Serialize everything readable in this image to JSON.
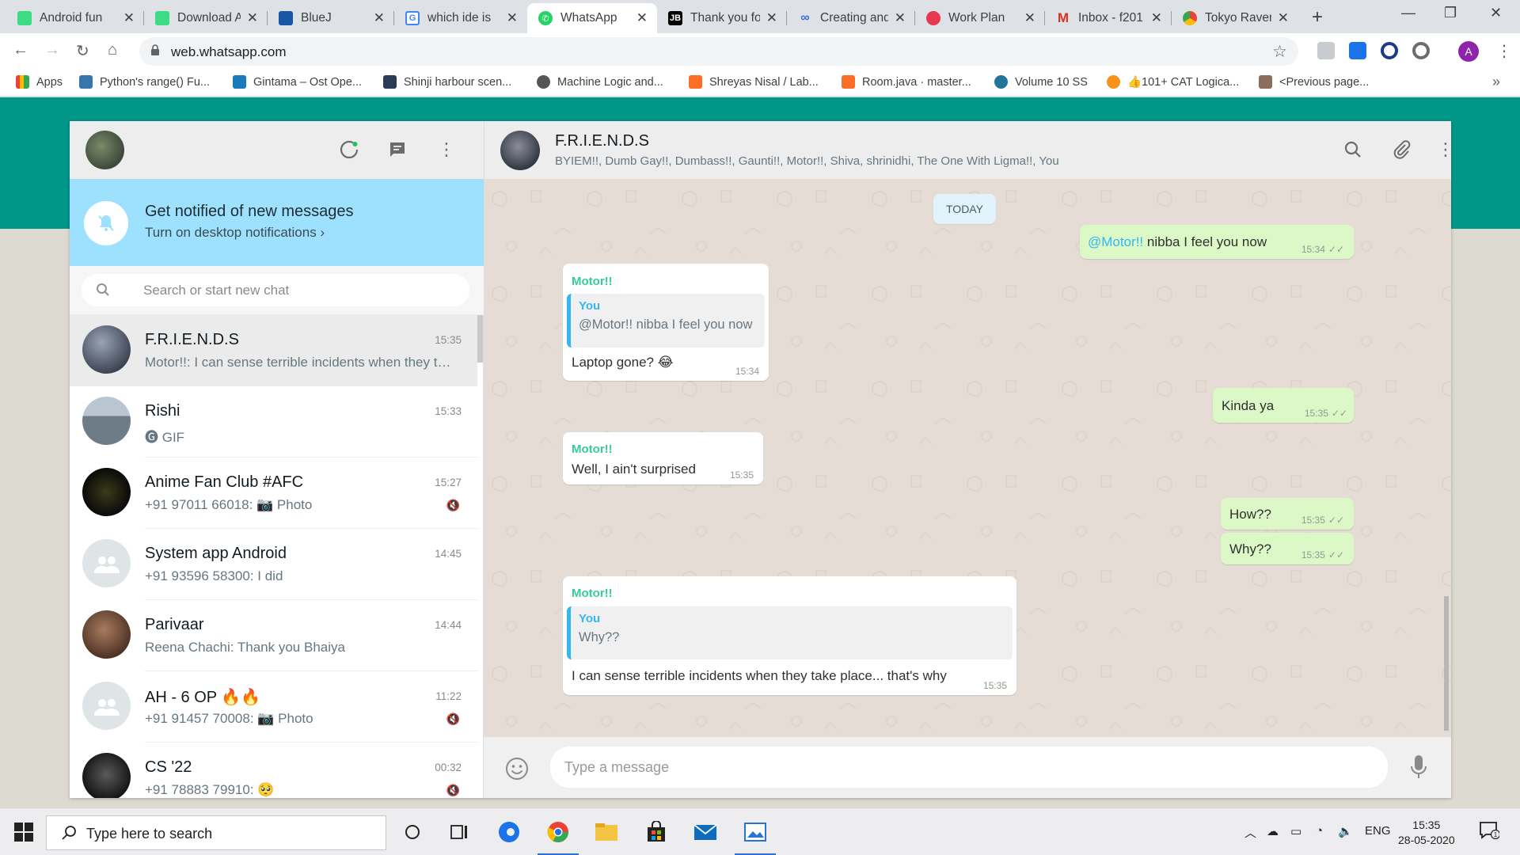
{
  "browser": {
    "tabs": [
      {
        "label": "Android fun",
        "icon": "android-developers-icon",
        "color": "#3ddc84"
      },
      {
        "label": "Download A",
        "icon": "android-studio-icon",
        "color": "#3ddc84"
      },
      {
        "label": "BlueJ",
        "icon": "bluej-icon",
        "color": "#1a56a8"
      },
      {
        "label": "which ide is",
        "icon": "google-icon",
        "color": "#4285f4"
      },
      {
        "label": "WhatsApp",
        "icon": "whatsapp-icon",
        "color": "#25d366",
        "active": true
      },
      {
        "label": "Thank you fo",
        "icon": "jetbrains-icon",
        "color": "#000000"
      },
      {
        "label": "Creating and",
        "icon": "link-icon",
        "color": "#3a6bd8"
      },
      {
        "label": "Work Plan",
        "icon": "asana-icon",
        "color": "#e8384f"
      },
      {
        "label": "Inbox - f201",
        "icon": "gmail-icon",
        "color": "#d93025"
      },
      {
        "label": "Tokyo Raven",
        "icon": "chrome-icon",
        "color": "#fbbc04"
      }
    ],
    "url": "web.whatsapp.com",
    "profile_initial": "A",
    "bookmarks": [
      {
        "label": "Apps",
        "icon": "apps-grid-icon",
        "color": "#4285f4"
      },
      {
        "label": "Python's range() Fu...",
        "icon": "python-icon",
        "color": "#3776ab"
      },
      {
        "label": "Gintama – Ost Ope...",
        "icon": "scribd-icon",
        "color": "#1a7bba"
      },
      {
        "label": "Shinji harbour scen...",
        "icon": "vlc-like-icon",
        "color": "#2b3a55"
      },
      {
        "label": "Machine Logic and...",
        "icon": "globe-icon",
        "color": "#555555"
      },
      {
        "label": "Shreyas Nisal / Lab...",
        "icon": "gitlab-icon",
        "color": "#fc6d26"
      },
      {
        "label": "Room.java · master...",
        "icon": "gitlab-icon",
        "color": "#fc6d26"
      },
      {
        "label": "Volume 10 SS",
        "icon": "wordpress-icon",
        "color": "#21759b"
      },
      {
        "label": "👍101+ CAT Logica...",
        "icon": "bitcoin-icon",
        "color": "#f7931a"
      },
      {
        "label": "<Previous page...",
        "icon": "avatar-icon",
        "color": "#8a6d5a"
      }
    ]
  },
  "whatsapp": {
    "notify_title": "Get notified of new messages",
    "notify_link": "Turn on desktop notifications ›",
    "search_placeholder": "Search or start new chat",
    "chats": [
      {
        "name": "F.R.I.E.N.D.S",
        "time": "15:35",
        "preview": "Motor!!: I can sense terrible incidents when they take place... that's why",
        "muted": false,
        "selected": true,
        "avatar_color": "#5a6272"
      },
      {
        "name": "Rishi",
        "time": "15:33",
        "preview": "🅖 GIF",
        "muted": false,
        "avatar_color": "#8c9aa8"
      },
      {
        "name": "Anime Fan Club #AFC",
        "time": "15:27",
        "preview": "+91 97011 66018: 📷 Photo",
        "muted": true,
        "avatar_color": "#1a1a1a"
      },
      {
        "name": "System app Android",
        "time": "14:45",
        "preview": "+91 93596 58300: I did",
        "muted": false,
        "avatar_color": "#dfe5e7"
      },
      {
        "name": "Parivaar",
        "time": "14:44",
        "preview": "Reena Chachi: Thank you Bhaiya",
        "muted": false,
        "avatar_color": "#7a5a48"
      },
      {
        "name": "AH - 6 OP 🔥🔥",
        "time": "11:22",
        "preview": "+91 91457 70008: 📷 Photo",
        "muted": true,
        "avatar_color": "#dfe5e7"
      },
      {
        "name": "CS '22",
        "time": "00:32",
        "preview": "+91 78883 79910: 🥺",
        "muted": true,
        "avatar_color": "#2a2a2a"
      }
    ],
    "conversation": {
      "title": "F.R.I.E.N.D.S",
      "members": "BYIEM!!, Dumb Gay!!, Dumbass!!, Gaunti!!, Motor!!, Shiva, shrinidhi, The One With Ligma!!, You",
      "date_divider": "TODAY",
      "messages": [
        {
          "dir": "out",
          "mention": "@Motor!!",
          "text": " nibba I feel you now",
          "time": "15:34"
        },
        {
          "dir": "in",
          "sender": "Motor!!",
          "quote_who": "You",
          "quote_text": "@Motor!! nibba I feel you now",
          "text": "Laptop gone? 😂",
          "time": "15:34"
        },
        {
          "dir": "out",
          "text": "Kinda ya",
          "time": "15:35"
        },
        {
          "dir": "in",
          "sender": "Motor!!",
          "text": "Well, I ain't surprised",
          "time": "15:35"
        },
        {
          "dir": "out",
          "text": "How??",
          "time": "15:35"
        },
        {
          "dir": "out",
          "text": "Why??",
          "time": "15:35"
        },
        {
          "dir": "in",
          "sender": "Motor!!",
          "quote_who": "You",
          "quote_text": "Why??",
          "text": "I can sense terrible incidents when they take place... that's why",
          "time": "15:35"
        }
      ],
      "input_placeholder": "Type a message"
    }
  },
  "taskbar": {
    "search_placeholder": "Type here to search",
    "lang": "ENG",
    "time": "15:35",
    "date": "28-05-2020",
    "notification_count": "1"
  }
}
